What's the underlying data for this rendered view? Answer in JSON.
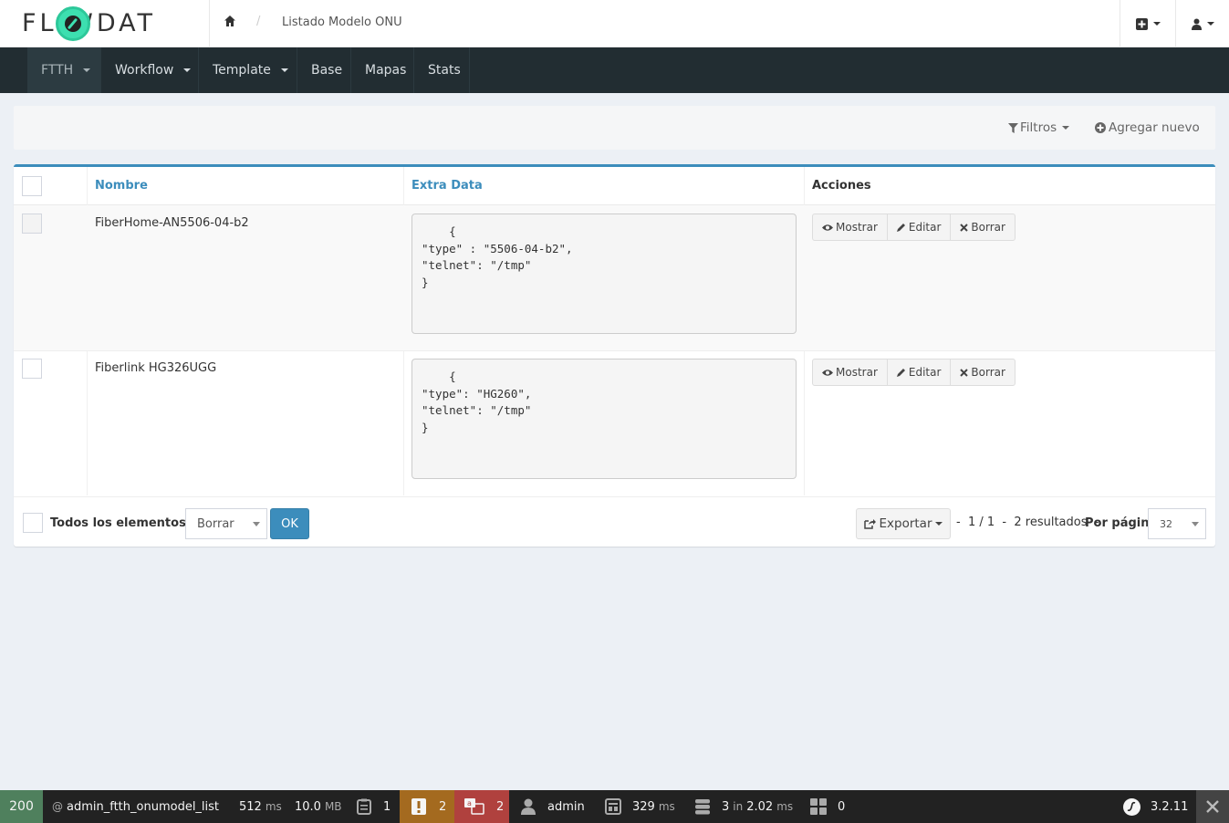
{
  "app": {
    "logo_text": "FL  WDAT",
    "breadcrumb_title": "Listado Modelo ONU"
  },
  "nav": {
    "items": [
      {
        "label": "FTTH",
        "dropdown": true,
        "active": true
      },
      {
        "label": "Workflow",
        "dropdown": true
      },
      {
        "label": "Template",
        "dropdown": true
      },
      {
        "label": "Base"
      },
      {
        "label": "Mapas"
      },
      {
        "label": "Stats"
      }
    ]
  },
  "actions_bar": {
    "filters_label": "Filtros",
    "add_new_label": "Agregar nuevo"
  },
  "table": {
    "columns": [
      "Nombre",
      "Extra Data",
      "Acciones"
    ],
    "rows": [
      {
        "nombre": "FiberHome-AN5506-04-b2",
        "extra_data": "    {\n\"type\" : \"5506-04-b2\",\n\"telnet\": \"/tmp\"\n}",
        "actions": [
          "Mostrar",
          "Editar",
          "Borrar"
        ]
      },
      {
        "nombre": "Fiberlink HG326UGG",
        "extra_data": "    {\n\"type\": \"HG260\",\n\"telnet\": \"/tmp\"\n}",
        "actions": [
          "Mostrar",
          "Editar",
          "Borrar"
        ]
      }
    ]
  },
  "batch": {
    "all_elements_label": "Todos los elementos (2)",
    "action_selected": "Borrar",
    "ok_label": "OK",
    "export_label": "Exportar",
    "pagination_text": "-  1 / 1  -  2 resultados  -",
    "per_page_label": "Por página",
    "per_page_value": "32"
  },
  "debug_toolbar": {
    "status": "200",
    "route": "admin_ftth_onumodel_list",
    "time_value": "512",
    "time_unit": "ms",
    "memory_value": "10.0",
    "memory_unit": "MB",
    "forms_count": "1",
    "logs_count": "2",
    "translations_count": "2",
    "user": "admin",
    "twig_time": "329",
    "twig_unit": "ms",
    "db_queries": "3",
    "db_in": "in",
    "db_time": "2.02",
    "db_unit": "ms",
    "widgets_count": "0",
    "symfony_version": "3.2.11",
    "colors": {
      "status_ok": "#4f805d",
      "logs_warning": "#a46a1f",
      "translations_error": "#b0413e"
    }
  }
}
